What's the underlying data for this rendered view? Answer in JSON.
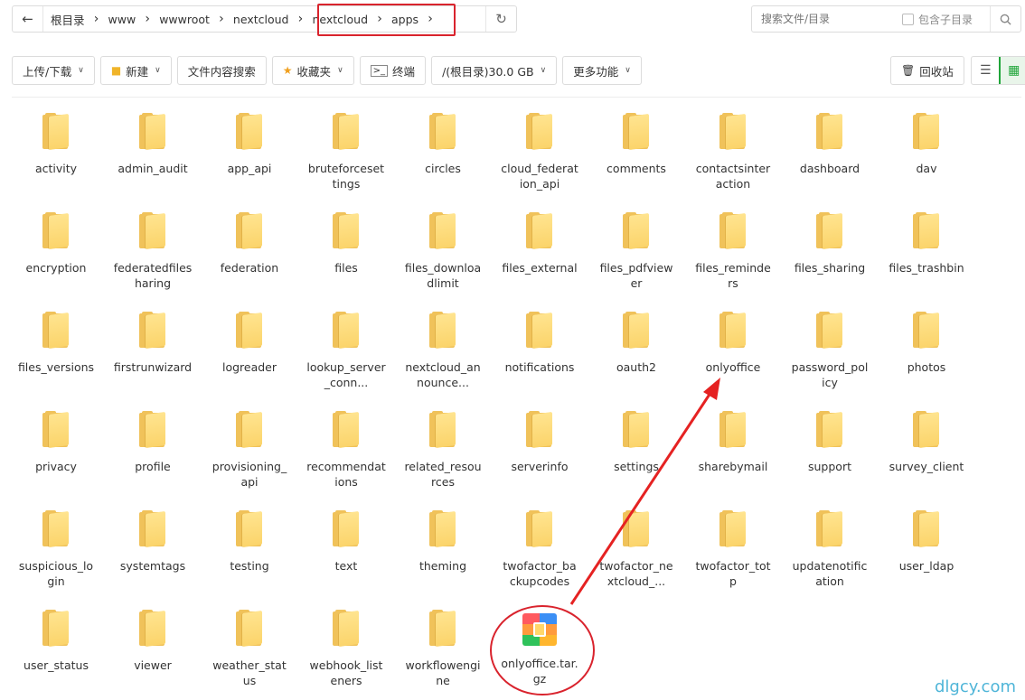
{
  "pathbar": {
    "crumbs": [
      "根目录",
      "www",
      "wwwroot",
      "nextcloud",
      "nextcloud",
      "apps"
    ]
  },
  "search": {
    "placeholder": "搜索文件/目录",
    "include_sub_label": "包含子目录"
  },
  "toolbar": {
    "upload_label": "上传/下载",
    "new_label": "新建",
    "content_search_label": "文件内容搜索",
    "favorites_label": "收藏夹",
    "terminal_label": "终端",
    "disk_label": "/(根目录)30.0 GB",
    "more_label": "更多功能",
    "recycle_label": "回收站"
  },
  "files": [
    {
      "name": "activity"
    },
    {
      "name": "admin_audit"
    },
    {
      "name": "app_api"
    },
    {
      "name": "bruteforcesettings"
    },
    {
      "name": "circles"
    },
    {
      "name": "cloud_federation_api"
    },
    {
      "name": "comments"
    },
    {
      "name": "contactsinteraction"
    },
    {
      "name": "dashboard"
    },
    {
      "name": "dav"
    },
    {
      "name": "encryption"
    },
    {
      "name": "federatedfilesharing"
    },
    {
      "name": "federation"
    },
    {
      "name": "files"
    },
    {
      "name": "files_downloadlimit"
    },
    {
      "name": "files_external"
    },
    {
      "name": "files_pdfviewer"
    },
    {
      "name": "files_reminders"
    },
    {
      "name": "files_sharing"
    },
    {
      "name": "files_trashbin"
    },
    {
      "name": "files_versions"
    },
    {
      "name": "firstrunwizard"
    },
    {
      "name": "logreader"
    },
    {
      "name": "lookup_server_conn..."
    },
    {
      "name": "nextcloud_announce..."
    },
    {
      "name": "notifications"
    },
    {
      "name": "oauth2"
    },
    {
      "name": "onlyoffice"
    },
    {
      "name": "password_policy"
    },
    {
      "name": "photos"
    },
    {
      "name": "privacy"
    },
    {
      "name": "profile"
    },
    {
      "name": "provisioning_api"
    },
    {
      "name": "recommendations"
    },
    {
      "name": "related_resources"
    },
    {
      "name": "serverinfo"
    },
    {
      "name": "settings"
    },
    {
      "name": "sharebymail"
    },
    {
      "name": "support"
    },
    {
      "name": "survey_client"
    },
    {
      "name": "suspicious_login"
    },
    {
      "name": "systemtags"
    },
    {
      "name": "testing"
    },
    {
      "name": "text"
    },
    {
      "name": "theming"
    },
    {
      "name": "twofactor_backupcodes"
    },
    {
      "name": "twofactor_nextcloud_..."
    },
    {
      "name": "twofactor_totp"
    },
    {
      "name": "updatenotification"
    },
    {
      "name": "user_ldap"
    },
    {
      "name": "user_status"
    },
    {
      "name": "viewer"
    },
    {
      "name": "weather_status"
    },
    {
      "name": "webhook_listeners"
    },
    {
      "name": "workflowengine"
    },
    {
      "name": "onlyoffice.tar.gz",
      "type": "archive"
    }
  ],
  "watermark": "dlgcy.com"
}
